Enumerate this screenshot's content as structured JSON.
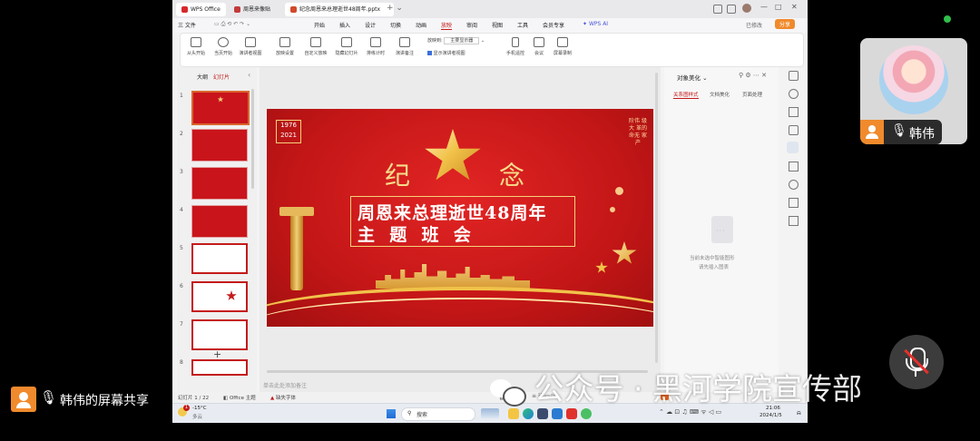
{
  "screen": {
    "tabs": [
      {
        "label": "WPS Office",
        "color": "#d9262d"
      },
      {
        "label": "周恩来像贴",
        "color": "#c43a3a"
      },
      {
        "label": "纪念周恩来总理逝世48周年.pptx",
        "color": "#d2492c"
      }
    ],
    "menu": {
      "file": "三 文件",
      "items": [
        "开始",
        "插入",
        "设计",
        "切换",
        "动画",
        "放映",
        "审阅",
        "视图",
        "工具",
        "会员专享"
      ],
      "active": "放映",
      "wps_ai": "WPS AI",
      "save_btn": "已修改",
      "share_btn": "分享"
    },
    "ribbon": {
      "buttons": [
        "从头开始",
        "当页开始",
        "演讲者视图",
        "放映设置",
        "自定义放映",
        "隐藏幻灯片",
        "排练计时",
        "演讲备注"
      ],
      "monitor_label": "放映到:",
      "monitor_value": "主要显示器",
      "checkbox_label": "显示演讲者视图",
      "right_buttons": [
        "手机遥控",
        "会议",
        "屏幕录制"
      ]
    },
    "leftpane": {
      "tab_outline": "大纲",
      "tab_slides": "幻灯片",
      "add": "+"
    },
    "slide": {
      "years_top": "1976",
      "years_bottom": "2021",
      "side_text": "阶伟 级大 革的 命无 家产",
      "big_left": "纪",
      "big_right": "念",
      "title_line1": "周恩来总理逝世48周年",
      "title_line2": "主  题  班  会"
    },
    "notes_placeholder": "单击此处添加备注",
    "rightpane": {
      "title": "对象美化",
      "tabs": [
        "关系图样式",
        "文档美化",
        "页面处理"
      ],
      "empty_line1": "当前未选中智能图形",
      "empty_line2": "请先插入图表"
    },
    "statusbar": {
      "slide_count": "幻灯片 1 / 22",
      "theme": "Office 主题",
      "font_missing": "缺失字体",
      "beautify": "智能美化"
    },
    "taskbar": {
      "weather_temp": "-15°C",
      "weather_desc": "多云",
      "weather_badge": "1",
      "search": "搜索",
      "time": "21:06",
      "date": "2024/1/5"
    }
  },
  "participant": {
    "name": "韩伟",
    "share_label": "韩伟的屏幕共享"
  },
  "watermark": "公众号 · 黑河学院宣传部",
  "colors": {
    "accent": "#c41a1a",
    "status_green": "#2fbf4a",
    "orange": "#f08a2c",
    "gold": "#f4d27a"
  }
}
